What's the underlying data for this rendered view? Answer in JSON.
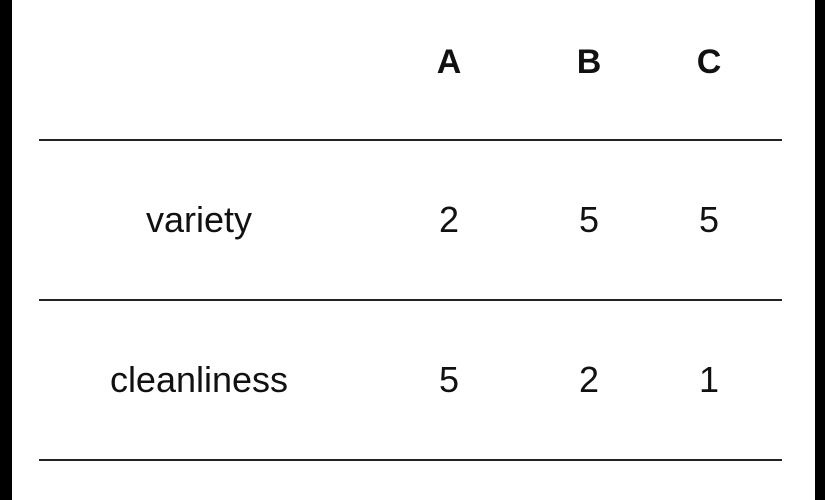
{
  "table": {
    "headers": [
      "",
      "A",
      "B",
      "C"
    ],
    "rows": [
      [
        "variety",
        "2",
        "5",
        "5"
      ],
      [
        "cleanliness",
        "5",
        "2",
        "1"
      ]
    ]
  }
}
